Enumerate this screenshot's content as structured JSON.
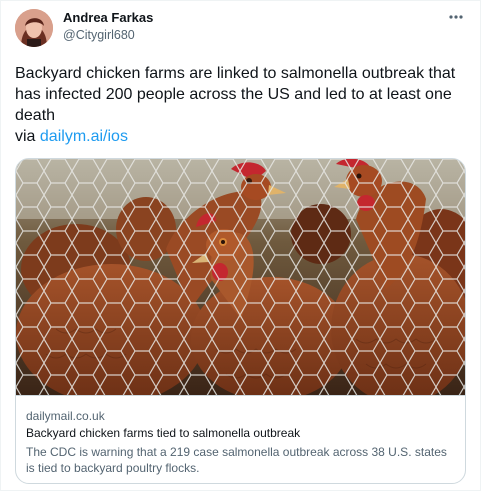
{
  "user": {
    "name": "Andrea Farkas",
    "handle": "@Citygirl680"
  },
  "tweet": {
    "text": "Backyard chicken farms are linked to salmonella outbreak that has infected 200 people across the US and led to at least one death",
    "via_prefix": "via ",
    "link": "dailym.ai/ios"
  },
  "card": {
    "domain": "dailymail.co.uk",
    "title": "Backyard chicken farms tied to salmonella outbreak",
    "description": "The CDC is warning that a 219 case salmonella outbreak across 38 U.S. states is tied to backyard poultry flocks."
  },
  "icons": {
    "more": "more-horizontal-icon",
    "image": "chickens-behind-wire-fence"
  },
  "colors": {
    "link": "#1d9bf0",
    "secondary_text": "#536471",
    "border": "#cfd9de"
  }
}
